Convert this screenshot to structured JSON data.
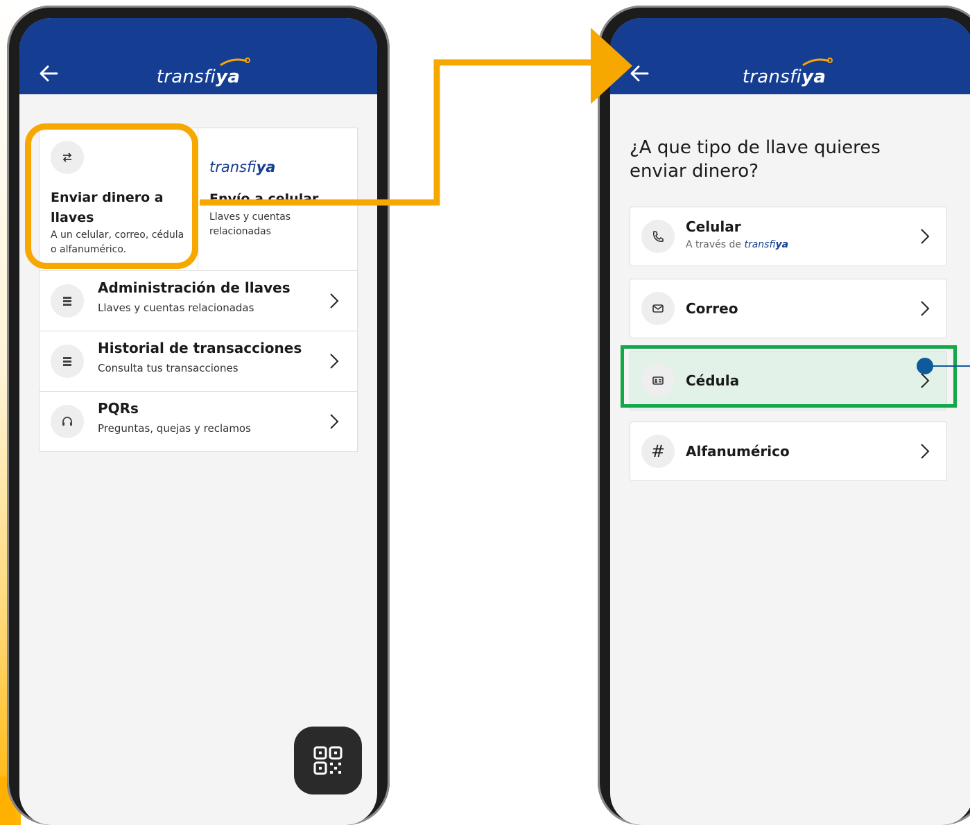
{
  "brand": {
    "logo_main": "transfi",
    "logo_bold": "ya",
    "header_color": "#153d92",
    "highlight_orange": "#f7a800",
    "highlight_green": "#12a84a"
  },
  "left_screen": {
    "card_send": {
      "icon": "swap-arrows-icon",
      "title": "Enviar dinero a llaves",
      "subtitle": "A un celular, correo, cédula o alfanumérico."
    },
    "card_transfiya": {
      "logo_main": "transfi",
      "logo_bold": "ya",
      "title": "Envío a celular",
      "subtitle": "Llaves y cuentas relacionadas"
    },
    "menu": [
      {
        "icon": "list-icon",
        "title": "Administración de llaves",
        "subtitle": "Llaves y cuentas relacionadas"
      },
      {
        "icon": "list-icon",
        "title": "Historial de transacciones",
        "subtitle": "Consulta tus transacciones"
      },
      {
        "icon": "headset-icon",
        "title": "PQRs",
        "subtitle": "Preguntas, quejas y reclamos"
      }
    ],
    "qr_button_icon": "qr-code-icon"
  },
  "right_screen": {
    "question": "¿A que tipo de llave quieres enviar dinero?",
    "options": [
      {
        "icon": "phone-icon",
        "title": "Celular",
        "subtitle_prefix": "A través de",
        "subtitle_logo_main": "transfi",
        "subtitle_logo_bold": "ya"
      },
      {
        "icon": "mail-icon",
        "title": "Correo"
      },
      {
        "icon": "id-card-icon",
        "title": "Cédula"
      },
      {
        "icon": "hash-icon",
        "title": "Alfanumérico"
      }
    ]
  }
}
